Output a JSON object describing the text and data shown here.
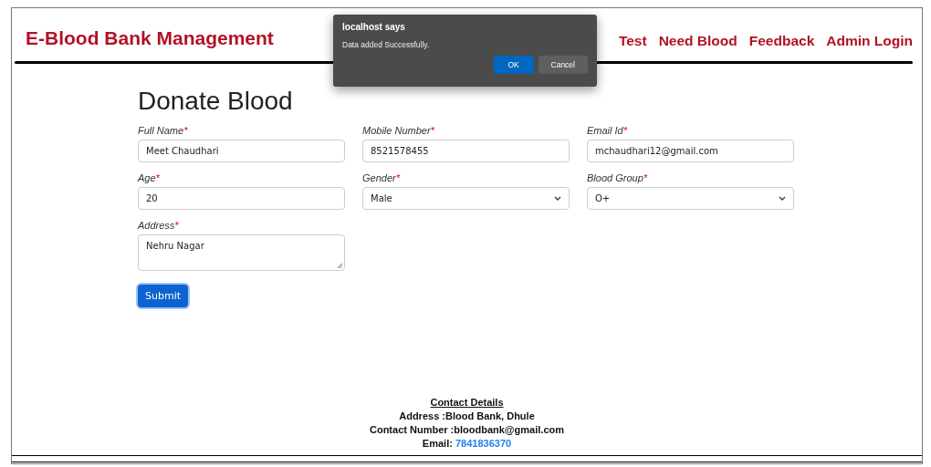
{
  "header": {
    "title": "E-Blood Bank Management",
    "nav": [
      {
        "label": "Test"
      },
      {
        "label": "Need Blood"
      },
      {
        "label": "Feedback"
      },
      {
        "label": "Admin Login"
      }
    ]
  },
  "form": {
    "heading": "Donate Blood",
    "fields": [
      {
        "kind": "input",
        "label": "Full Name",
        "mark": "*",
        "value": "Meet Chaudhari"
      },
      {
        "kind": "input",
        "label": "Mobile Number",
        "mark": "*",
        "value": "8521578455"
      },
      {
        "kind": "input",
        "label": "Email Id",
        "mark": "*",
        "value": "mchaudhari12@gmail.com"
      },
      {
        "kind": "input",
        "label": "Age",
        "mark": "*",
        "value": "20"
      },
      {
        "kind": "select",
        "label": "Gender",
        "mark": "*",
        "value": "Male"
      },
      {
        "kind": "select",
        "label": "Blood Group",
        "mark": "*",
        "value": "O+"
      },
      {
        "kind": "textarea",
        "label": "Address",
        "mark": "*",
        "value": "Nehru Nagar"
      }
    ],
    "submit": "Submit"
  },
  "footer": {
    "heading": "Contact Details",
    "lines": [
      "Address :Blood Bank, Dhule",
      "Contact Number :bloodbank@gmail.com"
    ],
    "email_label": "Email:",
    "email_link": "7841836370"
  },
  "dialog": {
    "title": "localhost says",
    "message": "Data added Successfully.",
    "buttons": [
      {
        "label": "OK",
        "primary": true
      },
      {
        "label": "Cancel",
        "primary": false
      }
    ]
  }
}
